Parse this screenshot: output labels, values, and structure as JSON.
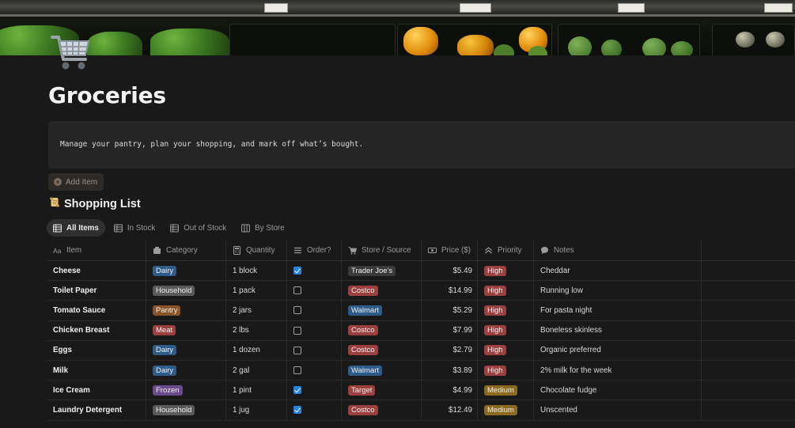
{
  "page": {
    "title": "Groceries",
    "icon": "shopping-cart-icon",
    "description": "Manage your pantry, plan your shopping, and mark off what’s bought."
  },
  "actions": {
    "add_item_label": "Add Item"
  },
  "section": {
    "title": "Shopping List",
    "icon": "scroll-icon"
  },
  "views": [
    {
      "label": "All Items",
      "icon": "table-icon",
      "active": true
    },
    {
      "label": "In Stock",
      "icon": "table-icon",
      "active": false
    },
    {
      "label": "Out of Stock",
      "icon": "table-icon",
      "active": false
    },
    {
      "label": "By Store",
      "icon": "board-icon",
      "active": false
    }
  ],
  "columns": [
    {
      "label": "Item",
      "icon": "title-icon"
    },
    {
      "label": "Category",
      "icon": "folder-icon"
    },
    {
      "label": "Quantity",
      "icon": "calculator-icon"
    },
    {
      "label": "Order?",
      "icon": "list-icon"
    },
    {
      "label": "Store / Source",
      "icon": "cart-icon"
    },
    {
      "label": "Price ($)",
      "icon": "money-icon"
    },
    {
      "label": "Priority",
      "icon": "double-chevron-up-icon"
    },
    {
      "label": "Notes",
      "icon": "speech-bubble-icon"
    }
  ],
  "colors": {
    "Dairy": "#2e5c8a",
    "Household": "#5a5a5a",
    "Pantry": "#8a5428",
    "Meat": "#9b3f3f",
    "Frozen": "#6a4a8c",
    "Trader Joe's": "#3a3a3a",
    "Costco": "#9b3f3f",
    "Walmart": "#2e5c8a",
    "Target": "#9b3f3f",
    "High": "#9b3f3f",
    "Medium": "#8a6a1f"
  },
  "rows": [
    {
      "item": "Cheese",
      "category": "Dairy",
      "quantity": "1 block",
      "order": true,
      "store": "Trader Joe's",
      "price": "$5.49",
      "priority": "High",
      "notes": "Cheddar"
    },
    {
      "item": "Toilet Paper",
      "category": "Household",
      "quantity": "1 pack",
      "order": false,
      "store": "Costco",
      "price": "$14.99",
      "priority": "High",
      "notes": "Running low"
    },
    {
      "item": "Tomato Sauce",
      "category": "Pantry",
      "quantity": "2 jars",
      "order": false,
      "store": "Walmart",
      "price": "$5.29",
      "priority": "High",
      "notes": "For pasta night"
    },
    {
      "item": "Chicken Breast",
      "category": "Meat",
      "quantity": "2 lbs",
      "order": false,
      "store": "Costco",
      "price": "$7.99",
      "priority": "High",
      "notes": "Boneless skinless"
    },
    {
      "item": "Eggs",
      "category": "Dairy",
      "quantity": "1 dozen",
      "order": false,
      "store": "Costco",
      "price": "$2.79",
      "priority": "High",
      "notes": "Organic preferred"
    },
    {
      "item": "Milk",
      "category": "Dairy",
      "quantity": "2 gal",
      "order": false,
      "store": "Walmart",
      "price": "$3.89",
      "priority": "High",
      "notes": "2% milk for the week"
    },
    {
      "item": "Ice Cream",
      "category": "Frozen",
      "quantity": "1 pint",
      "order": true,
      "store": "Target",
      "price": "$4.99",
      "priority": "Medium",
      "notes": "Chocolate fudge"
    },
    {
      "item": "Laundry Detergent",
      "category": "Household",
      "quantity": "1 jug",
      "order": true,
      "store": "Costco",
      "price": "$12.49",
      "priority": "Medium",
      "notes": "Unscented"
    }
  ]
}
